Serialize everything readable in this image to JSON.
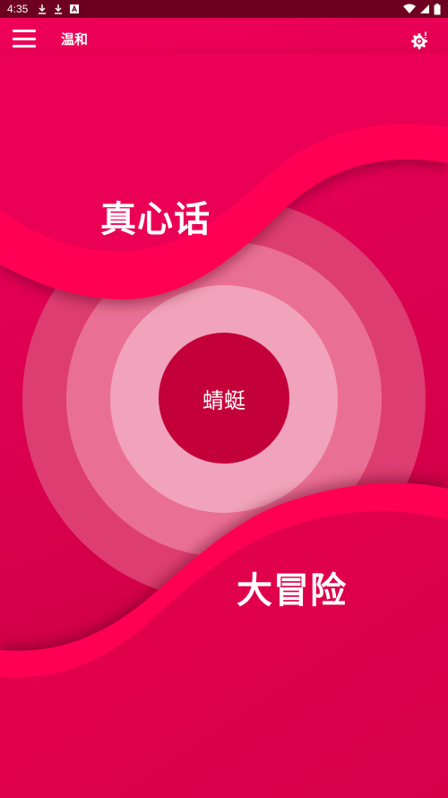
{
  "status_bar": {
    "time": "4:35"
  },
  "app_bar": {
    "title": "温和"
  },
  "game": {
    "truth_label": "真心话",
    "dare_label": "大冒险",
    "center_label": "蜻蜓"
  },
  "colors": {
    "background": "#e0004e",
    "status_bar": "#6d0020",
    "wave": "#ff0050",
    "center": "#c4003a"
  },
  "icons": {
    "menu": "hamburger-menu-icon",
    "settings": "gear-icon",
    "download": "download-icon",
    "wifi": "wifi-icon",
    "signal": "signal-icon",
    "battery": "battery-icon"
  }
}
